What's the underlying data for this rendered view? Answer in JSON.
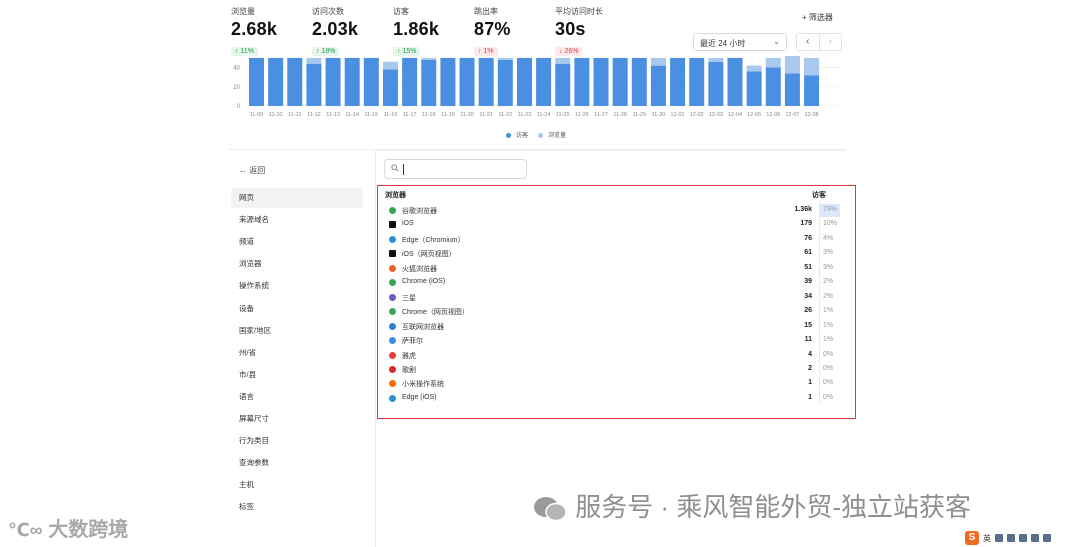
{
  "stats": [
    {
      "label": "浏览量",
      "value": "2.68k",
      "delta": "↑ 11%",
      "trend": "up"
    },
    {
      "label": "访问次数",
      "value": "2.03k",
      "delta": "↑ 18%",
      "trend": "up"
    },
    {
      "label": "访客",
      "value": "1.86k",
      "delta": "↑ 15%",
      "trend": "up"
    },
    {
      "label": "跳出率",
      "value": "87%",
      "delta": "↑ 1%",
      "trend": "down"
    },
    {
      "label": "平均访问时长",
      "value": "30s",
      "delta": "↓ 26%",
      "trend": "down"
    }
  ],
  "toolbar": {
    "filter_label": "+ 筛选器",
    "range_value": "最近 24 小时",
    "prev_icon": "‹",
    "next_icon": "›"
  },
  "chart_data": {
    "type": "bar",
    "stacked": true,
    "categories": [
      "11-09",
      "11-10",
      "11-11",
      "11-12",
      "11-13",
      "11-14",
      "11-15",
      "11-16",
      "11-17",
      "11-18",
      "11-19",
      "11-20",
      "11-21",
      "11-22",
      "11-23",
      "11-24",
      "11-25",
      "11-26",
      "11-27",
      "11-28",
      "11-29",
      "11-30",
      "12-01",
      "12-02",
      "12-03",
      "12-04",
      "12-05",
      "12-06",
      "12-07",
      "12-08"
    ],
    "series": [
      {
        "name": "访客",
        "color": "#4a8fe2",
        "values": [
          50,
          50,
          50,
          44,
          50,
          50,
          50,
          38,
          50,
          48,
          50,
          50,
          50,
          48,
          50,
          50,
          44,
          50,
          50,
          50,
          50,
          42,
          50,
          50,
          46,
          50,
          36,
          40,
          34,
          32
        ]
      },
      {
        "name": "浏览量",
        "color": "#a8c8f0",
        "values": [
          0,
          0,
          0,
          6,
          0,
          0,
          0,
          8,
          0,
          2,
          0,
          0,
          0,
          2,
          0,
          0,
          6,
          0,
          0,
          0,
          0,
          8,
          0,
          0,
          4,
          0,
          6,
          10,
          18,
          18
        ]
      }
    ],
    "y_ticks": [
      "40",
      "20",
      "0"
    ],
    "ylim": [
      0,
      52
    ],
    "legend": [
      "访客",
      "浏览量"
    ]
  },
  "sidebar": {
    "back_label": "← 返回",
    "items": [
      "网页",
      "来源域名",
      "频道",
      "浏览器",
      "操作系统",
      "设备",
      "国家/地区",
      "州/省",
      "市/县",
      "语言",
      "屏幕尺寸",
      "行为类目",
      "查询参数",
      "主机",
      "标签"
    ],
    "active_index": 0
  },
  "search": {
    "placeholder": ""
  },
  "table": {
    "col_browser": "浏览器",
    "col_visitors": "访客",
    "rows": [
      {
        "name": "谷歌浏览器",
        "count": "1.36k",
        "pct": "73%",
        "icon": "chrome-icon",
        "color": "#34a853"
      },
      {
        "name": "iOS",
        "count": "179",
        "pct": "10%",
        "icon": "ios-icon",
        "color": "#111111"
      },
      {
        "name": "Edge（Chromium）",
        "count": "76",
        "pct": "4%",
        "icon": "edge-icon",
        "color": "#2a8fd6"
      },
      {
        "name": "iOS（网页视图）",
        "count": "61",
        "pct": "3%",
        "icon": "ios-webview-icon",
        "color": "#111111"
      },
      {
        "name": "火狐浏览器",
        "count": "51",
        "pct": "3%",
        "icon": "firefox-icon",
        "color": "#e8622a"
      },
      {
        "name": "Chrome (iOS)",
        "count": "39",
        "pct": "2%",
        "icon": "chrome-ios-icon",
        "color": "#34a853"
      },
      {
        "name": "三星",
        "count": "34",
        "pct": "2%",
        "icon": "samsung-icon",
        "color": "#6a5acd"
      },
      {
        "name": "Chrome（网页视图）",
        "count": "26",
        "pct": "1%",
        "icon": "chrome-webview-icon",
        "color": "#34a853"
      },
      {
        "name": "互联网浏览器",
        "count": "15",
        "pct": "1%",
        "icon": "ie-icon",
        "color": "#2b7fd4"
      },
      {
        "name": "萨菲尔",
        "count": "11",
        "pct": "1%",
        "icon": "safari-icon",
        "color": "#3a8ee6"
      },
      {
        "name": "雅虎",
        "count": "4",
        "pct": "0%",
        "icon": "yandex-icon",
        "color": "#e8403a"
      },
      {
        "name": "歌剧",
        "count": "2",
        "pct": "0%",
        "icon": "opera-icon",
        "color": "#d9262b"
      },
      {
        "name": "小米操作系统",
        "count": "1",
        "pct": "0%",
        "icon": "miui-icon",
        "color": "#ff6a00"
      },
      {
        "name": "Edge (iOS)",
        "count": "1",
        "pct": "0%",
        "icon": "edge-ios-icon",
        "color": "#2a8fd6"
      }
    ]
  },
  "watermarks": {
    "bottom_left": "大数跨境",
    "bottom_right": "服务号 · 乘风智能外贸-独立站获客"
  },
  "taskbar": {
    "ime": "英"
  }
}
